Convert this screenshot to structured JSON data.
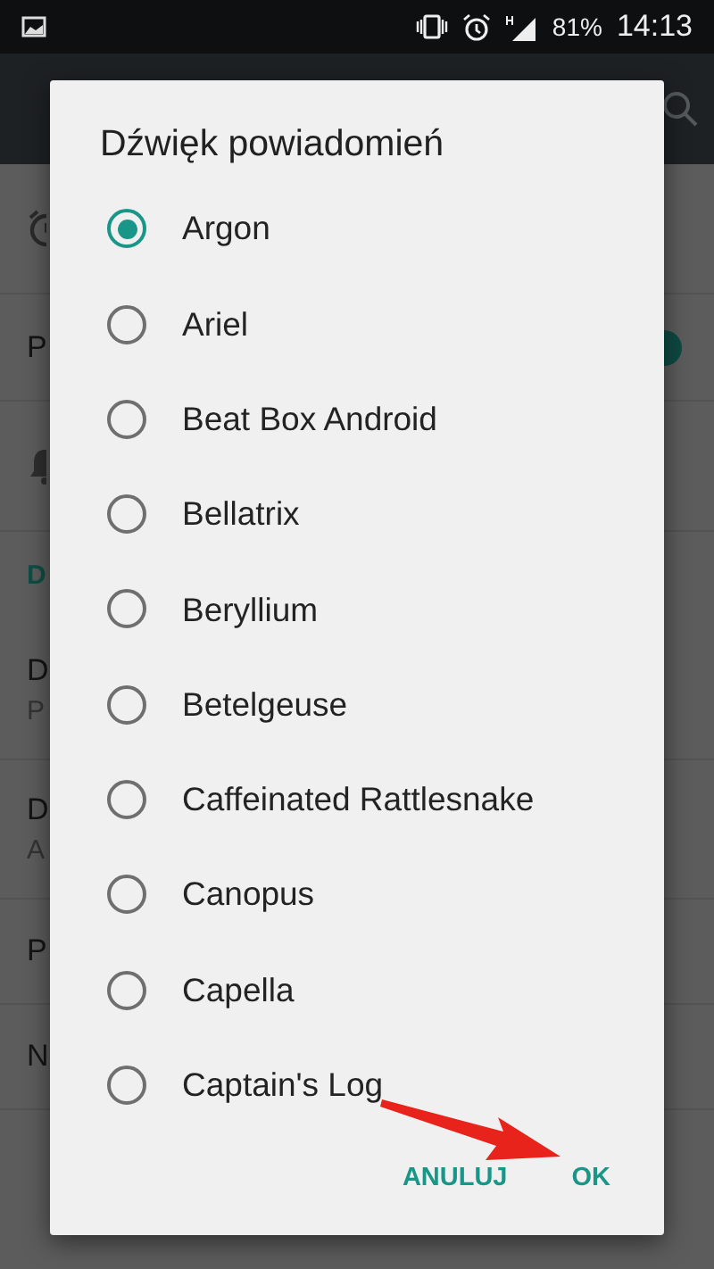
{
  "status_bar": {
    "battery": "81%",
    "time": "14:13"
  },
  "background": {
    "rows": [
      {
        "kind": "alarm"
      },
      {
        "kind": "switch",
        "title": "P",
        "on": true
      },
      {
        "kind": "bell"
      },
      {
        "kind": "header",
        "title": "D"
      },
      {
        "kind": "two-line",
        "title": "D",
        "subtitle": "P"
      },
      {
        "kind": "two-line",
        "title": "D",
        "subtitle": "A"
      },
      {
        "kind": "single",
        "title": "P"
      },
      {
        "kind": "single",
        "title": "N"
      }
    ]
  },
  "dialog": {
    "title": "Dźwięk powiadomień",
    "options": [
      {
        "label": "Argon",
        "selected": true
      },
      {
        "label": "Ariel",
        "selected": false
      },
      {
        "label": "Beat Box Android",
        "selected": false
      },
      {
        "label": "Bellatrix",
        "selected": false
      },
      {
        "label": "Beryllium",
        "selected": false
      },
      {
        "label": "Betelgeuse",
        "selected": false
      },
      {
        "label": "Caffeinated Rattlesnake",
        "selected": false
      },
      {
        "label": "Canopus",
        "selected": false
      },
      {
        "label": "Capella",
        "selected": false
      },
      {
        "label": "Captain's Log",
        "selected": false
      }
    ],
    "buttons": [
      {
        "label": "ANULUJ"
      },
      {
        "label": "OK"
      }
    ]
  }
}
